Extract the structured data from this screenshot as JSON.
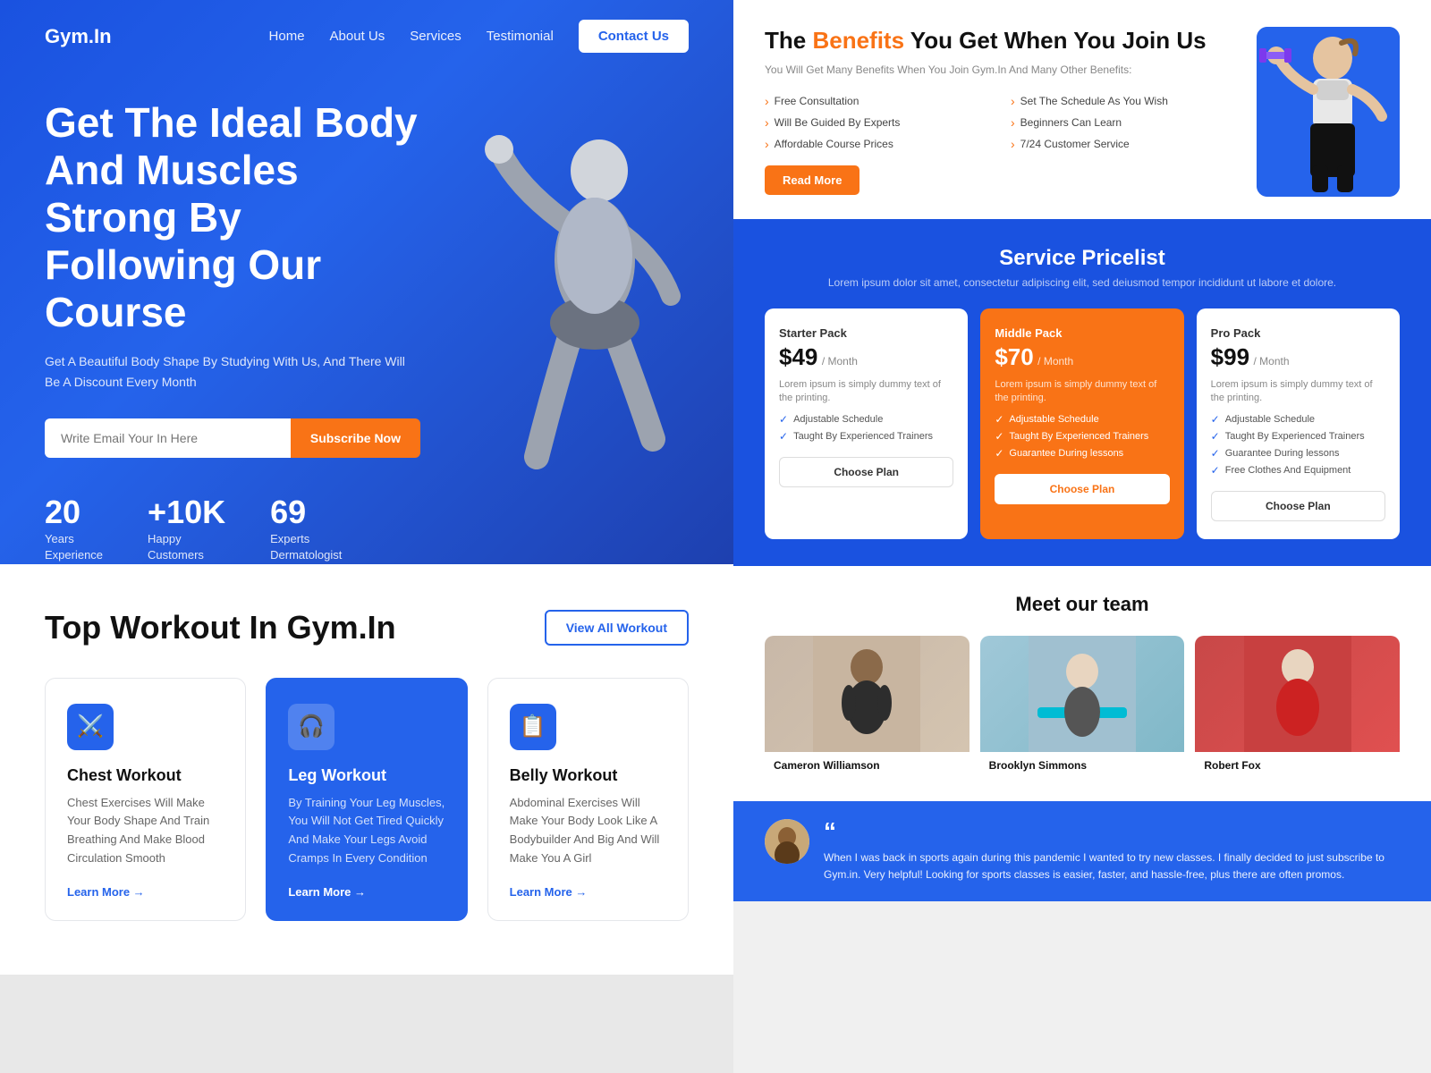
{
  "site": {
    "logo": "Gym.In",
    "nav": {
      "links": [
        "Home",
        "About Us",
        "Services",
        "Testimonial"
      ],
      "cta": "Contact Us"
    }
  },
  "hero": {
    "title": "Get The Ideal Body And Muscles Strong By Following Our Course",
    "subtitle": "Get A Beautiful Body Shape By Studying With Us, And There Will Be A Discount Every Month",
    "email_placeholder": "Write Email Your In Here",
    "subscribe_label": "Subscribe Now",
    "stats": [
      {
        "number": "20",
        "label": "Years\nExperience"
      },
      {
        "number": "+10K",
        "label": "Happy\nCustomers"
      },
      {
        "number": "69",
        "label": "Experts\nDermatologist"
      }
    ]
  },
  "benefits": {
    "title_prefix": "The ",
    "title_highlight": "Benefits",
    "title_suffix": " You Get When You Join Us",
    "subtitle": "You Will Get Many Benefits When You Join Gym.In And Many Other Benefits:",
    "items": [
      "Free Consultation",
      "Set The Schedule As You Wish",
      "Will Be Guided By Experts",
      "Beginners Can Learn",
      "Affordable Course Prices",
      "7/24 Customer Service"
    ],
    "read_more": "Read More"
  },
  "pricing": {
    "title": "Service Pricelist",
    "subtitle": "Lorem ipsum dolor sit amet, consectetur adipiscing elit, sed deiusmod tempor incididunt ut labore et dolore.",
    "plans": [
      {
        "name": "Starter Pack",
        "price": "$49",
        "period": "/ Month",
        "desc": "Lorem ipsum is simply dummy text of the printing.",
        "features": [
          "Adjustable Schedule",
          "Taught By Experienced Trainers"
        ],
        "cta": "Choose Plan",
        "featured": false
      },
      {
        "name": "Middle Pack",
        "price": "$70",
        "period": "/ Month",
        "desc": "Lorem ipsum is simply dummy text of the printing.",
        "features": [
          "Adjustable Schedule",
          "Taught By Experienced Trainers",
          "Guarantee During lessons"
        ],
        "cta": "Choose Plan",
        "featured": true
      },
      {
        "name": "Pro Pack",
        "price": "$99",
        "period": "/ Month",
        "desc": "Lorem ipsum is simply dummy text of the printing.",
        "features": [
          "Adjustable Schedule",
          "Taught By Experienced Trainers",
          "Guarantee During lessons",
          "Free Clothes And Equipment"
        ],
        "cta": "Choose Plan",
        "featured": false
      }
    ]
  },
  "workout": {
    "section_title": "Top Workout In Gym.In",
    "view_all_label": "View All Workout",
    "cards": [
      {
        "icon": "🏋",
        "title": "Chest Workout",
        "desc": "Chest Exercises Will Make Your Body Shape And Train Breathing And Make Blood Circulation Smooth",
        "learn_more": "Learn More →",
        "featured": false
      },
      {
        "icon": "🎧",
        "title": "Leg Workout",
        "desc": "By Training Your Leg Muscles, You Will Not Get Tired Quickly And Make Your Legs Avoid Cramps In Every Condition",
        "learn_more": "Learn More →",
        "featured": true
      },
      {
        "icon": "📊",
        "title": "Belly Workout",
        "desc": "Abdominal Exercises Will Make Your Body Look Like A Bodybuilder And Big And Will Make You A Girl",
        "learn_more": "Learn More →",
        "featured": false
      }
    ]
  },
  "team": {
    "title": "Meet our team",
    "members": [
      {
        "name": "Cameron Williamson",
        "photo_bg": "yoga"
      },
      {
        "name": "Brooklyn Simmons",
        "photo_bg": "mat"
      },
      {
        "name": "Robert Fox",
        "photo_bg": "red"
      }
    ]
  },
  "testimonial": {
    "quote": "“",
    "text": "When I was back in sports again during this pandemic I wanted to try new classes. I finally decided to just subscribe to Gym.in. Very helpful! Looking for sports classes is easier, faster, and hassle-free, plus there are often promos."
  }
}
